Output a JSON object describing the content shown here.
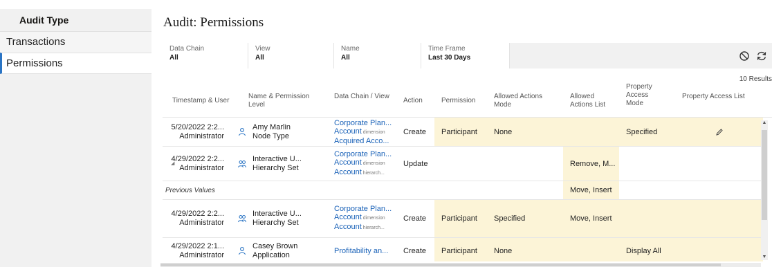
{
  "sidebar": {
    "heading": "Audit Type",
    "items": [
      {
        "label": "Transactions",
        "active": false
      },
      {
        "label": "Permissions",
        "active": true
      }
    ]
  },
  "page": {
    "title": "Audit: Permissions",
    "results": "10 Results"
  },
  "filters": [
    {
      "label": "Data Chain",
      "value": "All"
    },
    {
      "label": "View",
      "value": "All"
    },
    {
      "label": "Name",
      "value": "All"
    },
    {
      "label": "Time Frame",
      "value": "Last 30 Days"
    }
  ],
  "toolbar": {
    "icons": [
      "reset-icon",
      "refresh-icon"
    ]
  },
  "columns": [
    "Timestamp & User",
    "Name & Permission Level",
    "Data Chain / View",
    "Action",
    "Permission",
    "Allowed Actions Mode",
    "Allowed Actions List",
    "Property Access Mode",
    "Property Access List"
  ],
  "rows": [
    {
      "timestamp": "5/20/2022 2:2...",
      "user": "Administrator",
      "user_icon": "user-icon",
      "name": "Amy Marlin",
      "level": "Node Type",
      "chain_line1": "Corporate Plan...",
      "chain_line2": "Account",
      "chain_line2_sub": "dimension",
      "chain_line3": "Acquired Acco...",
      "chain_line3_sub": "",
      "action": "Create",
      "permission": "Participant",
      "aa_mode": "None",
      "aa_list": "",
      "pa_mode": "Specified",
      "pa_list_icon": "edit-pencil-icon"
    },
    {
      "timestamp": "4/29/2022 2:2...",
      "user": "Administrator",
      "user_icon": "group-icon",
      "name": "Interactive U...",
      "level": "Hierarchy Set",
      "chain_line1": "Corporate Plan...",
      "chain_line2": "Account",
      "chain_line2_sub": "dimension",
      "chain_line3": "Account",
      "chain_line3_sub": "hierarch...",
      "action": "Update",
      "permission": "",
      "aa_mode": "",
      "aa_list": "Remove, M...",
      "pa_mode": "",
      "pa_list_icon": ""
    },
    {
      "previous_label": "Previous Values",
      "aa_list": "Move, Insert"
    },
    {
      "timestamp": "4/29/2022 2:2...",
      "user": "Administrator",
      "user_icon": "group-icon",
      "name": "Interactive U...",
      "level": "Hierarchy Set",
      "chain_line1": "Corporate Plan...",
      "chain_line2": "Account",
      "chain_line2_sub": "dimension",
      "chain_line3": "Account",
      "chain_line3_sub": "hierarch...",
      "action": "Create",
      "permission": "Participant",
      "aa_mode": "Specified",
      "aa_list": "Move, Insert",
      "pa_mode": "",
      "pa_list_icon": ""
    },
    {
      "timestamp": "4/29/2022 2:1...",
      "user": "Administrator",
      "user_icon": "user-icon",
      "name": "Casey Brown",
      "level": "Application",
      "chain_line1": "Profitability an...",
      "action": "Create",
      "permission": "Participant",
      "aa_mode": "None",
      "aa_list": "",
      "pa_mode": "Display All",
      "pa_list_icon": ""
    }
  ],
  "colors": {
    "accent": "#2a74c4",
    "highlight": "#fcf4d7",
    "link": "#1a62b8"
  }
}
